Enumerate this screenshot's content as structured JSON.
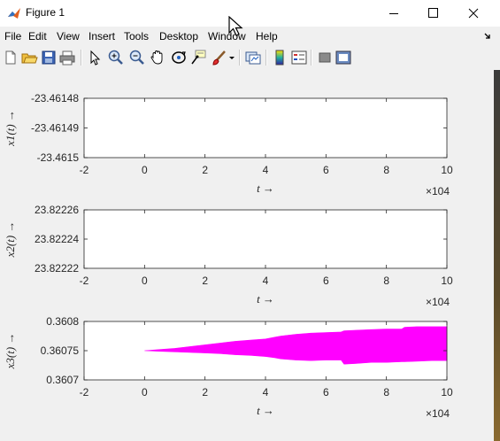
{
  "window": {
    "title": "Figure 1",
    "minimize_icon": "minimize-icon",
    "maximize_icon": "maximize-icon",
    "close_icon": "close-icon"
  },
  "menu": {
    "items": [
      "File",
      "Edit",
      "View",
      "Insert",
      "Tools",
      "Desktop",
      "Window",
      "Help"
    ]
  },
  "toolbar": {
    "buttons": [
      "new-figure-icon",
      "open-file-icon",
      "save-icon",
      "print-icon",
      "edit-plot-arrow-icon",
      "zoom-in-icon",
      "zoom-out-icon",
      "pan-hand-icon",
      "rotate-3d-icon",
      "data-cursor-icon",
      "brush-icon",
      "brush-dropdown-icon",
      "link-plot-icon",
      "insert-colorbar-icon",
      "insert-legend-icon",
      "hide-plot-tools-icon",
      "show-plot-tools-icon"
    ]
  },
  "chart_data": [
    {
      "type": "line",
      "xlabel": "t →",
      "ylabel": "x1(t) →",
      "xlim": [
        -20000,
        100000
      ],
      "ylim": [
        -23.4615,
        -23.46148
      ],
      "xticks": [
        "-2",
        "0",
        "2",
        "4",
        "6",
        "8",
        "10"
      ],
      "xtick_values": [
        -20000,
        0,
        20000,
        40000,
        60000,
        80000,
        100000
      ],
      "yticks": [
        "-23.46148",
        "-23.46149",
        "-23.4615"
      ],
      "ytick_values": [
        -23.46148,
        -23.46149,
        -23.4615
      ],
      "x_exponent": "×10^4",
      "series": []
    },
    {
      "type": "line",
      "xlabel": "t →",
      "ylabel": "x2(t) →",
      "xlim": [
        -20000,
        100000
      ],
      "ylim": [
        23.82222,
        23.82226
      ],
      "xticks": [
        "-2",
        "0",
        "2",
        "4",
        "6",
        "8",
        "10"
      ],
      "xtick_values": [
        -20000,
        0,
        20000,
        40000,
        60000,
        80000,
        100000
      ],
      "yticks": [
        "23.82226",
        "23.82224",
        "23.82222"
      ],
      "ytick_values": [
        23.82226,
        23.82224,
        23.82222
      ],
      "x_exponent": "×10^4",
      "series": []
    },
    {
      "type": "area",
      "xlabel": "t →",
      "ylabel": "x3(t) →",
      "xlim": [
        -20000,
        100000
      ],
      "ylim": [
        0.3607,
        0.3608
      ],
      "xticks": [
        "-2",
        "0",
        "2",
        "4",
        "6",
        "8",
        "10"
      ],
      "xtick_values": [
        -20000,
        0,
        20000,
        40000,
        60000,
        80000,
        100000
      ],
      "yticks": [
        "0.3608",
        "0.36075",
        "0.3607"
      ],
      "ytick_values": [
        0.3608,
        0.36075,
        0.3607
      ],
      "x_exponent": "×10^4",
      "series": [
        {
          "color": "#ff00ff",
          "x": [
            0,
            5000,
            10000,
            15000,
            20000,
            25000,
            30000,
            35000,
            40000,
            43000,
            45000,
            50000,
            55000,
            60000,
            65000,
            66000,
            70000,
            75000,
            80000,
            85000,
            86000,
            90000,
            95000,
            100000
          ],
          "upper": [
            0.36075,
            0.360752,
            0.360754,
            0.360757,
            0.36076,
            0.360763,
            0.360766,
            0.360768,
            0.36077,
            0.360773,
            0.360775,
            0.360778,
            0.36078,
            0.360781,
            0.360782,
            0.360784,
            0.360785,
            0.360786,
            0.360787,
            0.360787,
            0.36079,
            0.360791,
            0.360791,
            0.360791
          ],
          "lower": [
            0.36075,
            0.360749,
            0.360748,
            0.360747,
            0.360746,
            0.360745,
            0.360743,
            0.360742,
            0.36074,
            0.360738,
            0.360736,
            0.360734,
            0.360733,
            0.360734,
            0.360734,
            0.360727,
            0.360728,
            0.36073,
            0.36073,
            0.360731,
            0.360731,
            0.360732,
            0.360733,
            0.360733
          ]
        }
      ]
    }
  ]
}
